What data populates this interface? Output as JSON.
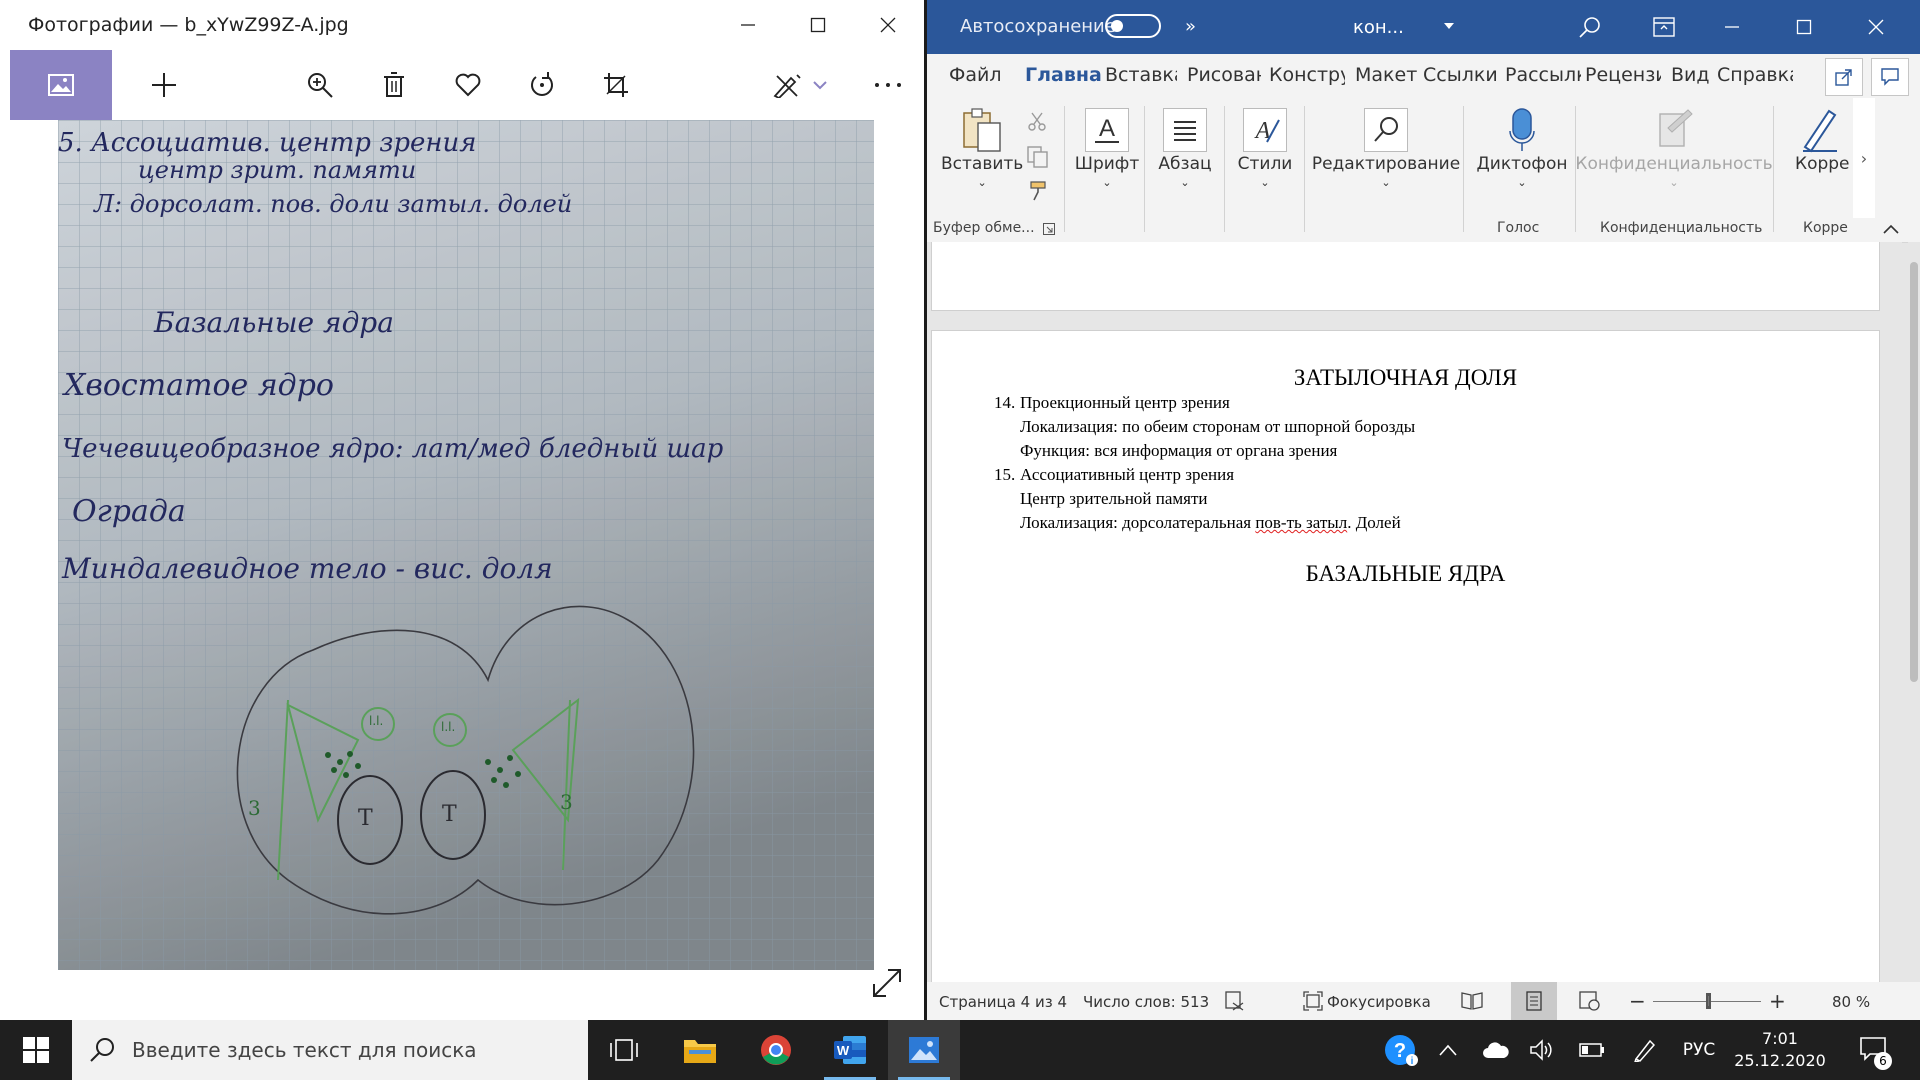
{
  "photos": {
    "title": "Фотографии — b_xYwZ99Z-A.jpg",
    "photo_notes": {
      "line1": "5. Ассоциатив. центр зрения",
      "line2": "центр зрит. памяти",
      "line3": "Л: дорсолат. пов. доли затыл. долей",
      "heading": "Базальные ядра",
      "item1": "Хвостатое ядро",
      "item2": "Чечевицеобразное ядро: лат/мед бледный шар",
      "item3": "Ограда",
      "item4": "Миндалевидное тело - вис. доля",
      "label_t": "Т",
      "label_3": "3",
      "label_ll": "l.l."
    }
  },
  "word": {
    "autosave_label": "Автосохранение",
    "doc_name": "кон...",
    "tabs": [
      "Файл",
      "Главная",
      "Вставка",
      "Рисован",
      "Констру",
      "Макет",
      "Ссылки",
      "Рассылк",
      "Рецензи",
      "Вид",
      "Справка"
    ],
    "ribbon": {
      "paste": "Вставить",
      "clipboard_group": "Буфер обме...",
      "font": "Шрифт",
      "paragraph": "Абзац",
      "styles": "Стили",
      "editing": "Редактирование",
      "dictate": "Диктофон",
      "voice_group": "Голос",
      "sensitivity": "Конфиденциальность",
      "sensitivity_group": "Конфиденциальность",
      "editor": "Корре",
      "editor_group": "Корре"
    },
    "document": {
      "heading1": "ЗАТЫЛОЧНАЯ ДОЛЯ",
      "item14_num": "14.",
      "item14_title": "Проекционный центр зрения",
      "item14_line2": "Локализация: по обеим сторонам от шпорной борозды",
      "item14_line3": "Функция: вся информация от органа зрения",
      "item15_num": "15.",
      "item15_title": "Ассоциативный центр зрения",
      "item15_line2": "Центр зрительной памяти",
      "item15_line3_a": "Локализация: дорсолатеральная ",
      "item15_line3_b": "пов-ть затыл",
      "item15_line3_c": ". Долей",
      "heading2": "БАЗАЛЬНЫЕ ЯДРА"
    },
    "status": {
      "page": "Страница 4 из 4",
      "words": "Число слов: 513",
      "focus": "Фокусировка",
      "zoom": "80 %"
    }
  },
  "taskbar": {
    "search_placeholder": "Введите здесь текст для поиска",
    "language": "РУС",
    "time": "7:01",
    "date": "25.12.2020",
    "notifications": "6"
  },
  "colors": {
    "word_blue": "#2b579a",
    "photos_accent": "#8b83c3",
    "taskbar": "#1f1f1f"
  }
}
